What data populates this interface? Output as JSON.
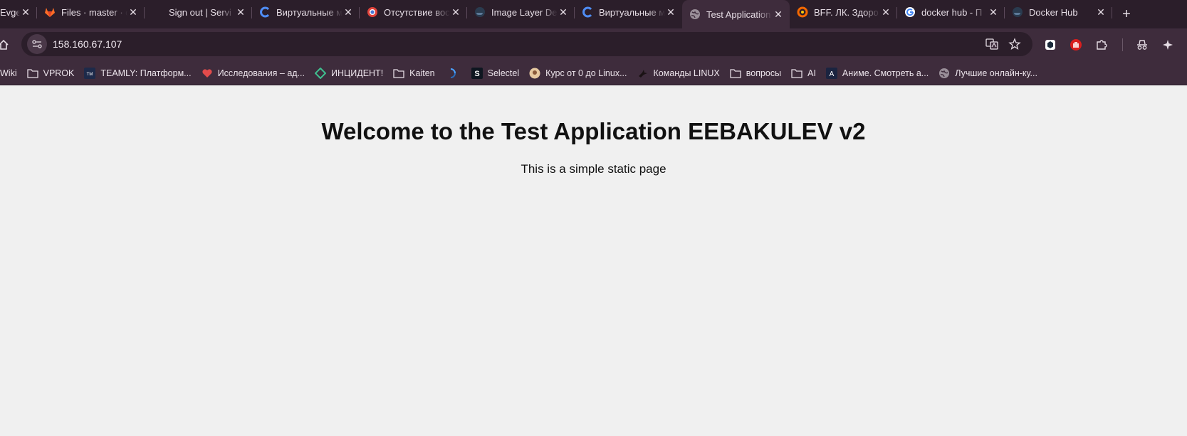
{
  "tabs": [
    {
      "title": "Evgeni",
      "icon": "wiki-icon"
    },
    {
      "title": "Files · master · c",
      "icon": "gitlab-icon"
    },
    {
      "title": "Sign out | Servi",
      "icon": "blank-icon"
    },
    {
      "title": "Виртуальные м",
      "icon": "cloud-c-icon"
    },
    {
      "title": "Отсутствие вос",
      "icon": "chrome-like-icon"
    },
    {
      "title": "Image Layer De",
      "icon": "docker-icon"
    },
    {
      "title": "Виртуальные м",
      "icon": "cloud-c-icon"
    },
    {
      "title": "Test Application",
      "icon": "globe-icon",
      "active": true
    },
    {
      "title": "BFF. ЛК. Здоро",
      "icon": "grafana-icon"
    },
    {
      "title": "docker hub - П",
      "icon": "google-icon"
    },
    {
      "title": "Docker Hub",
      "icon": "docker-icon"
    }
  ],
  "toolbar": {
    "url": "158.160.67.107"
  },
  "bookmarks": [
    {
      "label": "Wiki",
      "icon": "wiki-icon"
    },
    {
      "label": "VPROK",
      "icon": "folder-icon"
    },
    {
      "label": "TEAMLY: Платформ...",
      "icon": "teamly-icon"
    },
    {
      "label": "Исследования – ад...",
      "icon": "heart-icon"
    },
    {
      "label": "ИНЦИДЕНТ!",
      "icon": "diamond-icon"
    },
    {
      "label": "Kaiten",
      "icon": "folder-icon"
    },
    {
      "label": "",
      "icon": "loader-icon"
    },
    {
      "label": "Selectel",
      "icon": "selectel-icon"
    },
    {
      "label": "Курс от 0 до Linux...",
      "icon": "avatar-icon"
    },
    {
      "label": "Команды LINUX",
      "icon": "bird-icon"
    },
    {
      "label": "вопросы",
      "icon": "folder-icon"
    },
    {
      "label": "AI",
      "icon": "folder-icon"
    },
    {
      "label": "Аниме. Смотреть а...",
      "icon": "anime-icon"
    },
    {
      "label": "Лучшие онлайн-ку...",
      "icon": "globe-icon"
    }
  ],
  "page": {
    "heading": "Welcome to the Test Application EEBAKULEV v2",
    "subtitle": "This is a simple static page"
  },
  "colors": {
    "frame": "#2b1e2a",
    "toolbar": "#3e2c3c",
    "page_bg": "#f0f0f0"
  }
}
